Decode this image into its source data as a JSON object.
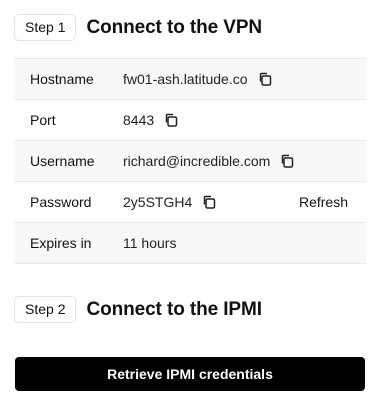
{
  "step1": {
    "badge": "Step 1",
    "title": "Connect to the VPN"
  },
  "vpn": {
    "rows": [
      {
        "label": "Hostname",
        "value": "fw01-ash.latitude.co",
        "copyable": true
      },
      {
        "label": "Port",
        "value": "8443",
        "copyable": true
      },
      {
        "label": "Username",
        "value": "richard@incredible.com",
        "copyable": true
      },
      {
        "label": "Password",
        "value": "2y5STGH4",
        "copyable": true,
        "action": "Refresh"
      },
      {
        "label": "Expires in",
        "value": "11 hours",
        "copyable": false
      }
    ]
  },
  "step2": {
    "badge": "Step 2",
    "title": "Connect to the IPMI"
  },
  "ipmi": {
    "button_label": "Retrieve IPMI credentials"
  },
  "icons": {
    "copy": "copy-icon"
  },
  "colors": {
    "button_bg": "#000000",
    "button_text": "#ffffff",
    "row_alt_bg": "#f8f8f8",
    "border": "#e9e9e9"
  }
}
